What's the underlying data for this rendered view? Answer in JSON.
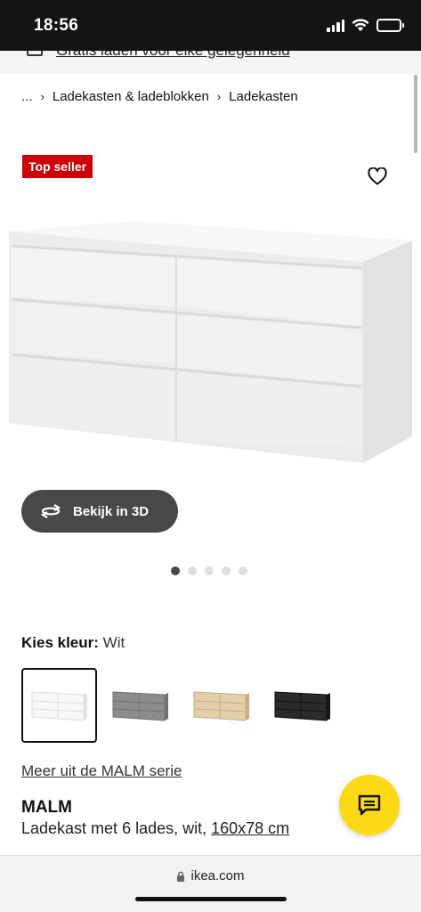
{
  "status": {
    "time": "18:56"
  },
  "topstrip": {
    "link": "Gratis laden voor elke gelegenheid"
  },
  "breadcrumb": {
    "ellipsis": "...",
    "sep": "›",
    "level1": "Ladekasten & ladeblokken",
    "level2": "Ladekasten"
  },
  "badge": "Top seller",
  "view3d": {
    "label": "Bekijk in 3D"
  },
  "gallery": {
    "count": 5,
    "active_index": 0
  },
  "color": {
    "label": "Kies kleur:",
    "value": "Wit",
    "options": [
      {
        "name": "wit",
        "color": "#f4f4f4"
      },
      {
        "name": "grijs",
        "color": "#8a8c8e"
      },
      {
        "name": "eikeneffect",
        "color": "#e3cfaa"
      },
      {
        "name": "zwartbruin",
        "color": "#2b2b2b"
      }
    ],
    "selected_index": 0
  },
  "series_link": "Meer uit de MALM serie",
  "product": {
    "name": "MALM",
    "desc": "Ladekast met 6 lades, wit, ",
    "dims": "160x78 cm"
  },
  "browser": {
    "url": "ikea.com"
  },
  "colors": {
    "badge": "#cc0008",
    "chat": "#fbd914",
    "button3d": "#484848"
  }
}
